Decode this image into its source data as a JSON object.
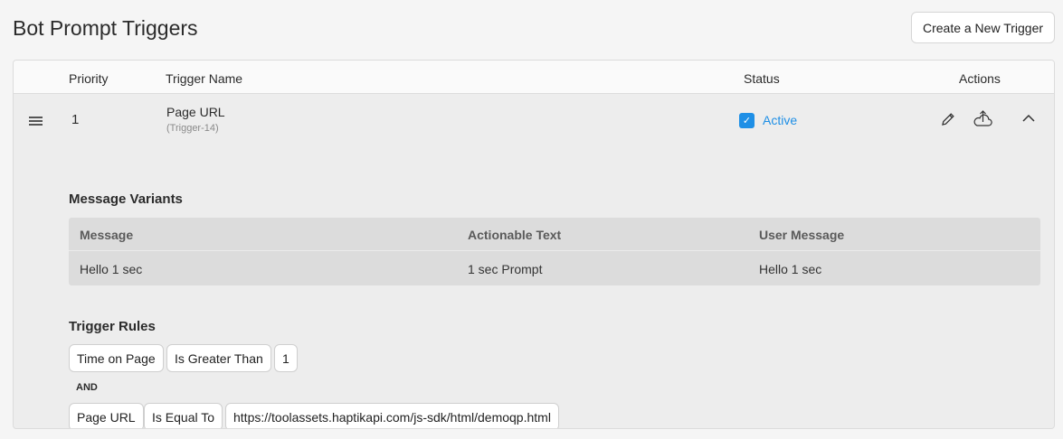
{
  "header": {
    "title": "Bot Prompt Triggers",
    "create_button": "Create a New Trigger"
  },
  "table": {
    "columns": {
      "priority": "Priority",
      "trigger_name": "Trigger Name",
      "status": "Status",
      "actions": "Actions"
    },
    "rows": [
      {
        "priority": "1",
        "name": "Page URL",
        "id": "(Trigger-14)",
        "status_checked": true,
        "status": "Active",
        "message_variants": {
          "title": "Message Variants",
          "columns": [
            "Message",
            "Actionable Text",
            "User Message"
          ],
          "rows": [
            [
              "Hello 1 sec",
              "1 sec Prompt",
              "Hello 1 sec"
            ]
          ]
        },
        "trigger_rules": {
          "title": "Trigger Rules",
          "rule1": [
            "Time on Page",
            "Is Greater Than",
            "1"
          ],
          "connector": "AND",
          "rule2": [
            "Page URL",
            "Is Equal To",
            "https://toolassets.haptikapi.com/js-sdk/html/demoqp.html"
          ]
        }
      }
    ]
  },
  "icons": {
    "drag": "drag-handle-icon",
    "edit": "pencil-icon",
    "upload": "cloud-upload-icon",
    "collapse": "chevron-up-icon",
    "checkbox": "checkbox-checked-icon"
  },
  "colors": {
    "accent": "#1e8fe6",
    "panel_bg": "#ededed",
    "header_bg": "#fafafa"
  }
}
